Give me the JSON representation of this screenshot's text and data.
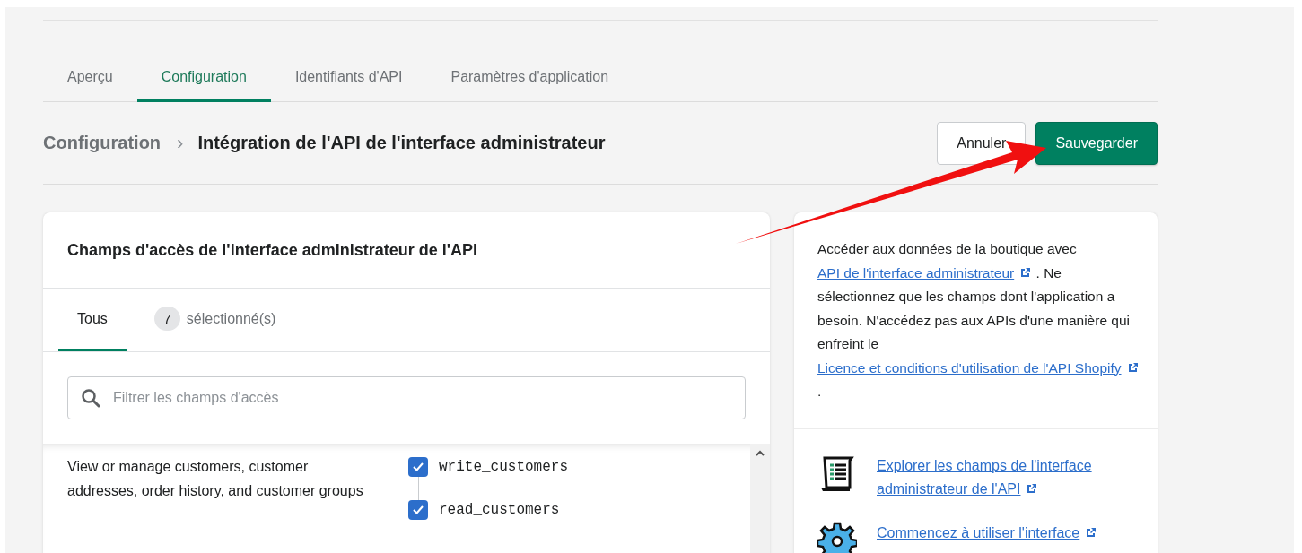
{
  "tabs": [
    {
      "label": "Aperçu",
      "selected": false
    },
    {
      "label": "Configuration",
      "selected": true
    },
    {
      "label": "Identifiants d'API",
      "selected": false
    },
    {
      "label": "Paramètres d'application",
      "selected": false
    }
  ],
  "breadcrumb": {
    "parent": "Configuration",
    "separator": "›",
    "current": "Intégration de l'API de l'interface administrateur"
  },
  "actions": {
    "cancel": "Annuler",
    "save": "Sauvegarder"
  },
  "scopes_card": {
    "title": "Champs d'accès de l'interface administrateur de l'API",
    "filter_tabs": [
      {
        "label": "Tous",
        "selected": true
      },
      {
        "count": "7",
        "label": "sélectionné(s)",
        "selected": false
      }
    ],
    "search": {
      "placeholder": "Filtrer les champs d'accès"
    },
    "scopes": [
      {
        "description": "View or manage customers, customer addresses, order history, and customer groups",
        "permissions": [
          {
            "name": "write_customers",
            "checked": true
          },
          {
            "name": "read_customers",
            "checked": true
          }
        ]
      }
    ]
  },
  "info_card": {
    "paragraph": [
      {
        "kind": "text",
        "text": "Accéder aux données de la boutique avec"
      },
      {
        "kind": "link",
        "text": "API de l'interface administrateur"
      },
      {
        "kind": "text",
        "text": ". Ne sélectionnez que les champs dont l'application a besoin. N'accédez pas aux APIs d'une manière qui enfreint le"
      },
      {
        "kind": "link",
        "text": "Licence et conditions d'utilisation de l'API Shopify"
      },
      {
        "kind": "text",
        "text": "."
      }
    ],
    "resources": [
      {
        "kind": "document",
        "text": "Explorer les champs de l'interface administrateur de l'API"
      },
      {
        "kind": "gear",
        "text": "Commencez à utiliser l'interface"
      }
    ]
  }
}
